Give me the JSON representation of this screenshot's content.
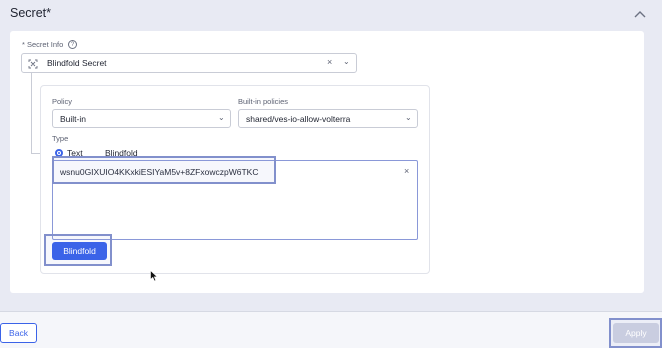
{
  "section": {
    "title": "Secret*"
  },
  "secret_info": {
    "label": "* Secret Info",
    "info_glyph": "?",
    "value": "Blindfold Secret"
  },
  "policy": {
    "label": "Policy",
    "value": "Built-in"
  },
  "builtin_policies": {
    "label": "Built-in policies",
    "value": "shared/ves-io-allow-volterra"
  },
  "type": {
    "label": "Type",
    "options": [
      {
        "label": "Text",
        "selected": true
      },
      {
        "label": "Blindfold",
        "selected": false
      }
    ]
  },
  "secret_text": {
    "value": "wsnu0GIXUIO4KKxkiESIYaM5v+8ZFxowczpW6TKC"
  },
  "glyphs": {
    "clear": "×",
    "chevron": "⌄"
  },
  "buttons": {
    "blindfold": "Blindfold",
    "back": "Back",
    "apply": "Apply"
  },
  "colors": {
    "accent": "#3b63e8",
    "highlight": "#8290cc",
    "disabled": "#c9cde0"
  }
}
